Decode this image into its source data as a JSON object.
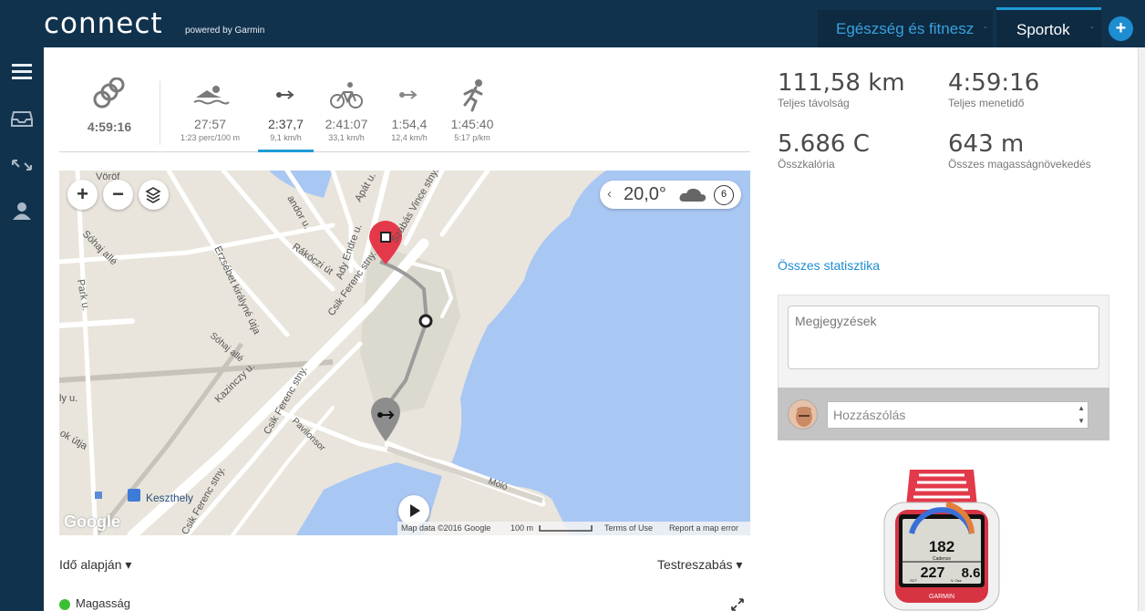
{
  "header": {
    "logo": "connect",
    "logo_sub": "powered by Garmin",
    "tabs": [
      {
        "label": "Egészség és fitnesz"
      },
      {
        "label": "Sportok"
      }
    ],
    "tab_sep": "-",
    "plus": "+"
  },
  "splits": [
    {
      "time": "4:59:16",
      "icon": "multisport-rings-icon"
    },
    {
      "time": "27:57",
      "sub": "1:23 perc/100 m",
      "icon": "swim-icon"
    },
    {
      "time": "2:37,7",
      "sub": "9,1 km/h",
      "icon": "transition-icon"
    },
    {
      "time": "2:41:07",
      "sub": "33,1 km/h",
      "icon": "bike-icon"
    },
    {
      "time": "1:54,4",
      "sub": "12,4 km/h",
      "icon": "transition-icon"
    },
    {
      "time": "1:45:40",
      "sub": "5:17 p/km",
      "icon": "run-icon"
    }
  ],
  "map": {
    "weather_temp": "20,0°",
    "wind": "6",
    "streets": [
      "Vöröf",
      "andor u.",
      "Apát u.",
      "Ady Endre u.",
      "Szabás Vince stny.",
      "Sóhaj allé",
      "Park u.",
      "Erzsébet királyné útja",
      "Rákóczi út",
      "Csik Ferenc stny.",
      "Sóhaj allé",
      "Kazinczy u.",
      "Csik Ferenc stny.",
      "Pavilonsor",
      "Móló",
      "Keszthely",
      "ly u.",
      "ok útja",
      "Csik Ferenc stny."
    ],
    "google": "Google",
    "footer": {
      "data": "Map data ©2016 Google",
      "scale": "100 m",
      "terms": "Terms of Use",
      "report": "Report a map error"
    }
  },
  "below_map": {
    "time_basis": "Idő alapján ▾",
    "customize": "Testreszabás ▾",
    "elevation": "Magasság"
  },
  "stats": [
    {
      "value": "111,58 km",
      "label": "Teljes távolság"
    },
    {
      "value": "4:59:16",
      "label": "Teljes menetidő"
    },
    {
      "value": "5.686 C",
      "label": "Összkalória"
    },
    {
      "value": "643 m",
      "label": "Összes magasságnövekedés"
    }
  ],
  "all_stats_link": "Összes statisztika",
  "notes": {
    "placeholder": "Megjegyzések",
    "comment_placeholder": "Hozzászólás"
  },
  "watch": {
    "top_value": "182",
    "top_label": "Cadence",
    "left_value": "227",
    "right_value": "8.6",
    "brand": "GARMIN",
    "left_label": "SCT",
    "right_label": "V. Osz."
  },
  "colors": {
    "header_bg": "#11324d",
    "accent": "#1e9bd7",
    "water": "#a9c7f3",
    "pin_red": "#e4394b"
  }
}
